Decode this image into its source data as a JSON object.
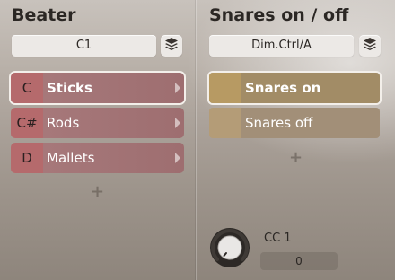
{
  "beater": {
    "title": "Beater",
    "selector_value": "C1",
    "items": [
      {
        "key": "C",
        "label": "Sticks",
        "selected": true
      },
      {
        "key": "C#",
        "label": "Rods",
        "selected": false
      },
      {
        "key": "D",
        "label": "Mallets",
        "selected": false
      }
    ],
    "add_symbol": "+",
    "icons": {
      "stack": "layers-icon",
      "chevron": "chevron-right-icon",
      "add": "plus-icon"
    }
  },
  "snares": {
    "title": "Snares on / off",
    "selector_value": "Dim.Ctrl/A",
    "items": [
      {
        "label": "Snares on",
        "selected": true
      },
      {
        "label": "Snares off",
        "selected": false
      }
    ],
    "add_symbol": "+",
    "icons": {
      "stack": "layers-icon",
      "add": "plus-icon",
      "knob": "knob-icon"
    }
  },
  "controller": {
    "label": "CC 1",
    "value": "0"
  },
  "colors": {
    "beater_key": "#b56a6c",
    "beater_body": "#a6787a",
    "snare_swatch": "#b79a63",
    "snare_body": "#a28c66"
  }
}
